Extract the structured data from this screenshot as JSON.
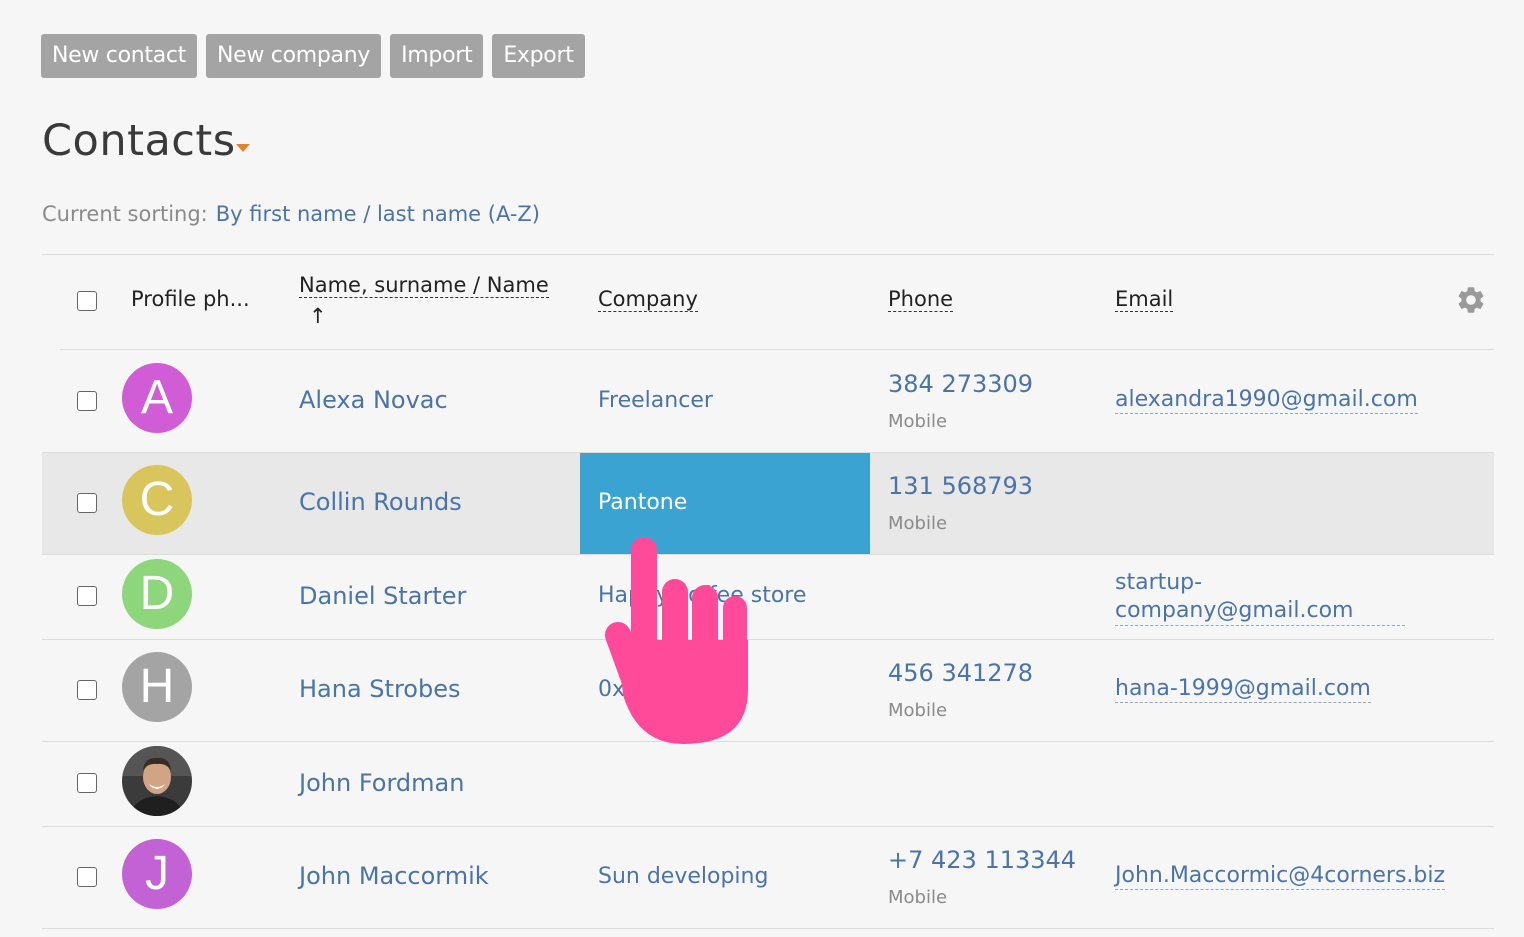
{
  "toolbar": {
    "new_contact": "New contact",
    "new_company": "New company",
    "import": "Import",
    "export": "Export"
  },
  "page": {
    "title": "Contacts"
  },
  "sorting": {
    "label": "Current sorting:",
    "value": "By first name / last name (A-Z)"
  },
  "table": {
    "headers": {
      "photo": "Profile ph...",
      "name": "Name, surname / Name",
      "sort_arrow": "↑",
      "company": "Company",
      "phone": "Phone",
      "email": "Email"
    },
    "rows": [
      {
        "initial": "A",
        "avatar_color": "#d15dd6",
        "name": "Alexa Novac",
        "company": "Freelancer",
        "phone": "384 273309",
        "phone_type": "Mobile",
        "email": "alexandra1990@gmail.com"
      },
      {
        "initial": "C",
        "avatar_color": "#d8c65c",
        "name": "Collin Rounds",
        "company": "Pantone",
        "phone": "131 568793",
        "phone_type": "Mobile",
        "email": ""
      },
      {
        "initial": "D",
        "avatar_color": "#8ed67c",
        "name": "Daniel Starter",
        "company": "Happy coffee store",
        "phone": "",
        "phone_type": "",
        "email_line1": "startup-",
        "email_line2": "company@gmail.com"
      },
      {
        "initial": "H",
        "avatar_color": "#a4a4a4",
        "name": "Hana Strobes",
        "company": "0x",
        "phone": "456 341278",
        "phone_type": "Mobile",
        "email": "hana-1999@gmail.com"
      },
      {
        "initial": "",
        "avatar_color": "#2b2b2b",
        "name": "John Fordman",
        "company": "",
        "phone": "",
        "phone_type": "",
        "email": ""
      },
      {
        "initial": "J",
        "avatar_color": "#c262d4",
        "name": "John Maccormik",
        "company": "Sun developing",
        "phone": "+7 423 113344",
        "phone_type": "Mobile",
        "email": "John.Maccormic@4corners.biz"
      }
    ]
  },
  "colors": {
    "accent": "#4a74a8",
    "selected_cell": "#3aa3d1",
    "row_highlight": "#e8e8e8",
    "cursor": "#ff4a9a"
  }
}
